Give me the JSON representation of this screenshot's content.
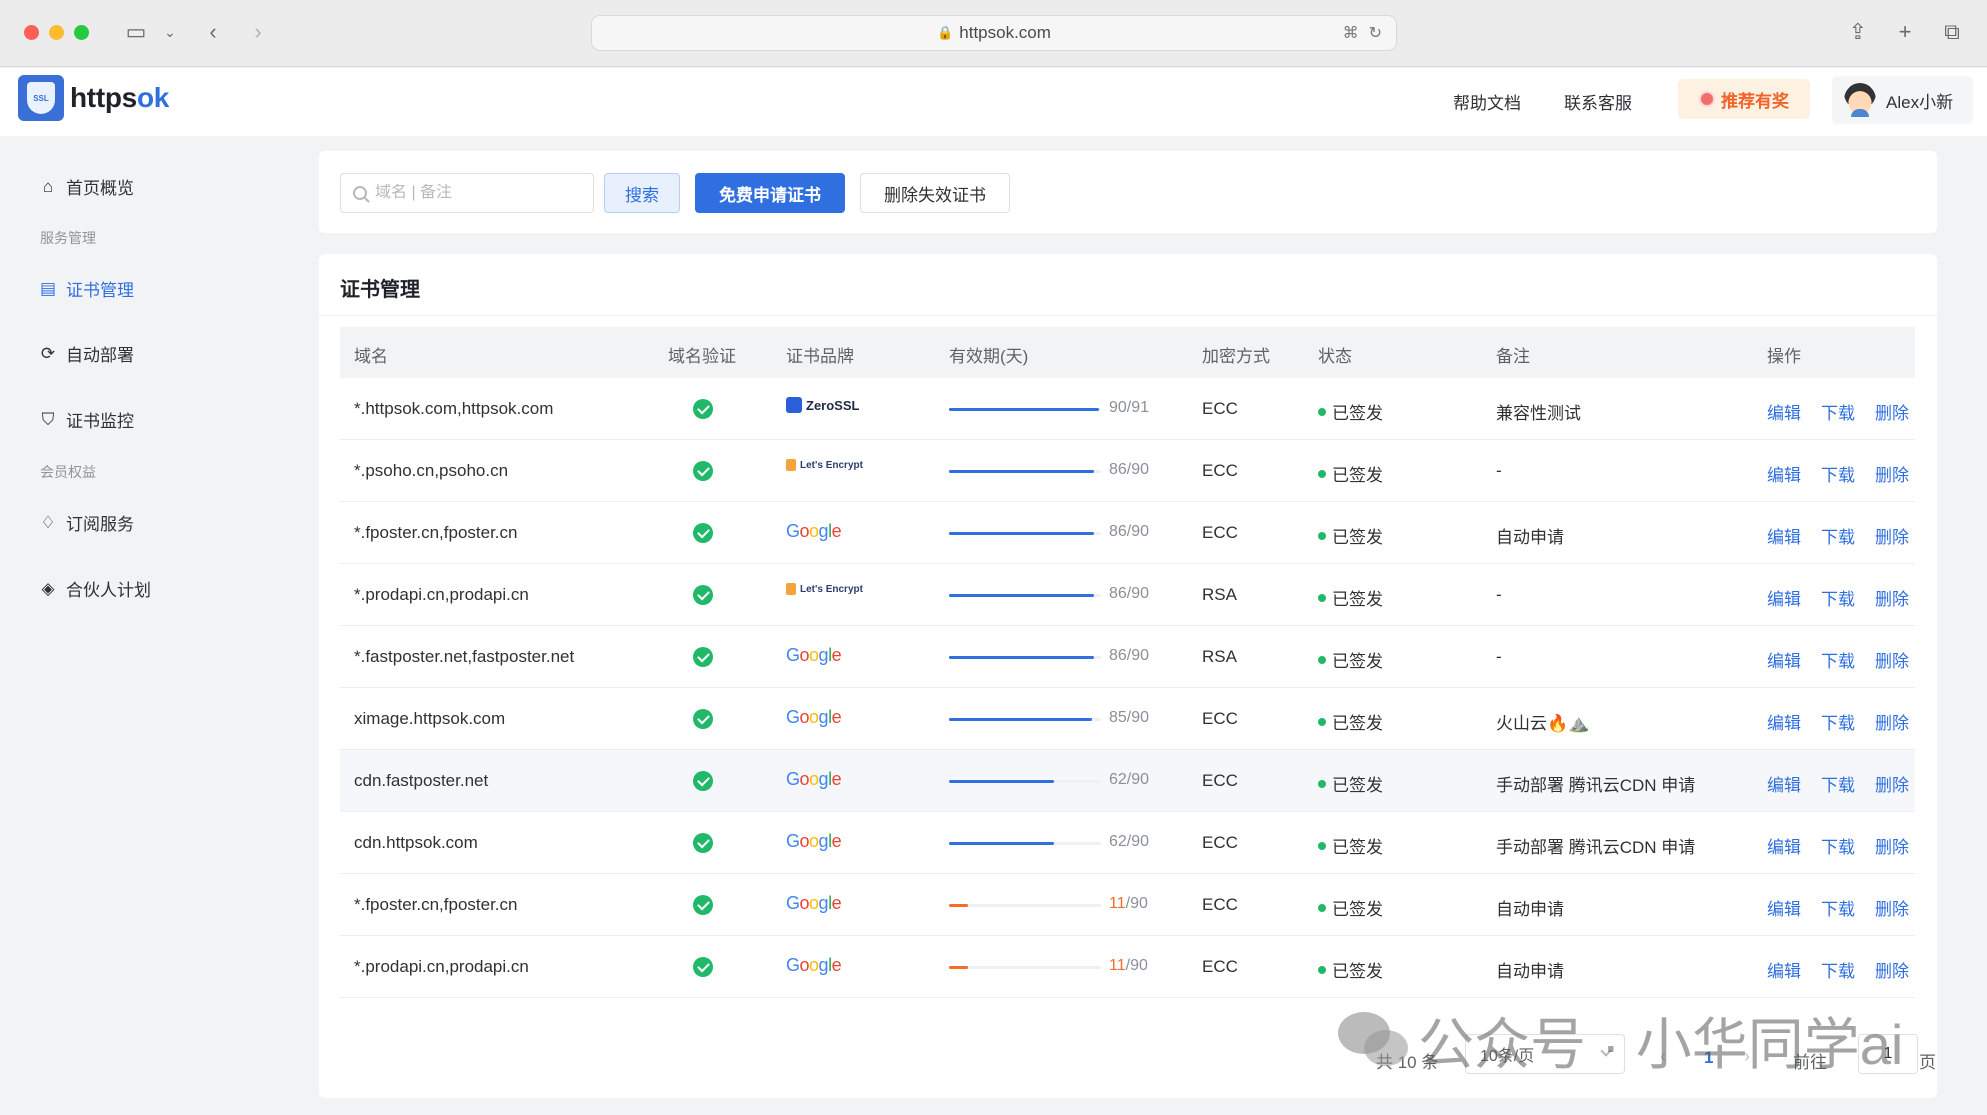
{
  "browser": {
    "url": "httpsok.com"
  },
  "header": {
    "brand_prefix": "https",
    "brand_suffix": "ok",
    "logo_text": "SSL",
    "help_docs": "帮助文档",
    "contact": "联系客服",
    "promo": "推荐有奖",
    "user_name": "Alex小新"
  },
  "sidebar": {
    "overview": "首页概览",
    "group_service": "服务管理",
    "cert_manage": "证书管理",
    "auto_deploy": "自动部署",
    "cert_monitor": "证书监控",
    "group_member": "会员权益",
    "subscription": "订阅服务",
    "partner": "合伙人计划"
  },
  "toolbar": {
    "search_placeholder": "域名 | 备注",
    "search_button": "搜索",
    "apply_button": "免费申请证书",
    "delete_button": "删除失效证书"
  },
  "main": {
    "title": "证书管理",
    "columns": {
      "domain": "域名",
      "verify": "域名验证",
      "brand": "证书品牌",
      "validity": "有效期(天)",
      "encryption": "加密方式",
      "status": "状态",
      "remark": "备注",
      "actions": "操作"
    },
    "actions": {
      "edit": "编辑",
      "download": "下载",
      "delete": "删除"
    },
    "rows": [
      {
        "domain": "*.httpsok.com,httpsok.com",
        "brand": "ZeroSSL",
        "used": 90,
        "total": 91,
        "encryption": "ECC",
        "status": "已签发",
        "remark": "兼容性测试"
      },
      {
        "domain": "*.psoho.cn,psoho.cn",
        "brand": "Let's Encrypt",
        "used": 86,
        "total": 90,
        "encryption": "ECC",
        "status": "已签发",
        "remark": "-"
      },
      {
        "domain": "*.fposter.cn,fposter.cn",
        "brand": "Google",
        "used": 86,
        "total": 90,
        "encryption": "ECC",
        "status": "已签发",
        "remark": "自动申请"
      },
      {
        "domain": "*.prodapi.cn,prodapi.cn",
        "brand": "Let's Encrypt",
        "used": 86,
        "total": 90,
        "encryption": "RSA",
        "status": "已签发",
        "remark": "-"
      },
      {
        "domain": "*.fastposter.net,fastposter.net",
        "brand": "Google",
        "used": 86,
        "total": 90,
        "encryption": "RSA",
        "status": "已签发",
        "remark": "-"
      },
      {
        "domain": "ximage.httpsok.com",
        "brand": "Google",
        "used": 85,
        "total": 90,
        "encryption": "ECC",
        "status": "已签发",
        "remark": "火山云🔥⛰️"
      },
      {
        "domain": "cdn.fastposter.net",
        "brand": "Google",
        "used": 62,
        "total": 90,
        "encryption": "ECC",
        "status": "已签发",
        "remark": "手动部署 腾讯云CDN 申请"
      },
      {
        "domain": "cdn.httpsok.com",
        "brand": "Google",
        "used": 62,
        "total": 90,
        "encryption": "ECC",
        "status": "已签发",
        "remark": "手动部署 腾讯云CDN 申请"
      },
      {
        "domain": "*.fposter.cn,fposter.cn",
        "brand": "Google",
        "used": 11,
        "total": 90,
        "encryption": "ECC",
        "status": "已签发",
        "remark": "自动申请"
      },
      {
        "domain": "*.prodapi.cn,prodapi.cn",
        "brand": "Google",
        "used": 11,
        "total": 90,
        "encryption": "ECC",
        "status": "已签发",
        "remark": "自动申请"
      }
    ]
  },
  "pagination": {
    "total": "共 10 条",
    "page_size": "10条/页",
    "current_page": "1",
    "goto_label": "前往",
    "goto_value": "1",
    "page_unit": "页"
  },
  "watermark": "公众号 · 小华同学ai",
  "colors": {
    "primary": "#2f6fe0",
    "success": "#21b86a",
    "warning": "#f56c2b"
  }
}
